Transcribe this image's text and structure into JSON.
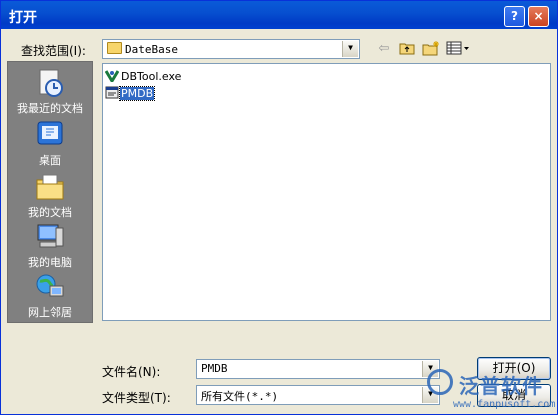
{
  "window": {
    "title": "打开",
    "help_glyph": "?",
    "close_glyph": "×"
  },
  "lookin": {
    "label": "查找范围(I):",
    "value": "DateBase"
  },
  "toolbar": {
    "back_icon": "back-arrow-icon",
    "up_icon": "up-folder-icon",
    "newfolder_icon": "new-folder-icon",
    "views_icon": "view-menu-icon"
  },
  "places": [
    {
      "label": "我最近的文档",
      "icon": "recent-documents-icon"
    },
    {
      "label": "桌面",
      "icon": "desktop-icon"
    },
    {
      "label": "我的文档",
      "icon": "my-documents-icon"
    },
    {
      "label": "我的电脑",
      "icon": "my-computer-icon"
    },
    {
      "label": "网上邻居",
      "icon": "network-places-icon"
    }
  ],
  "files": [
    {
      "name": "DBTool.exe",
      "icon": "exe-icon",
      "selected": false
    },
    {
      "name": "PMDB",
      "icon": "database-file-icon",
      "selected": true
    }
  ],
  "filename": {
    "label": "文件名(N):",
    "value": "PMDB"
  },
  "filetype": {
    "label": "文件类型(T):",
    "value": "所有文件(*.*)"
  },
  "buttons": {
    "open": "打开(O)",
    "cancel": "取消"
  },
  "watermark": {
    "text": "泛普软件",
    "url": "www.fanpusoft.com"
  }
}
